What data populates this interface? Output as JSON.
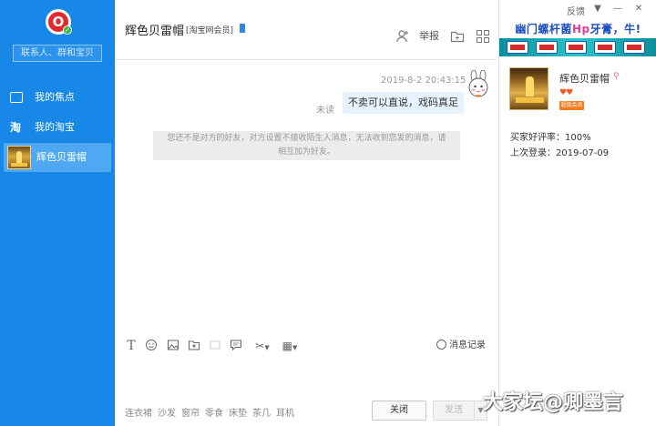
{
  "sidebar": {
    "logo_letter": "O",
    "search_placeholder": "联系人、群和宝贝",
    "items": [
      {
        "icon": "🖼",
        "label": "我的焦点"
      },
      {
        "icon": "淘",
        "label": "我的淘宝"
      },
      {
        "icon": "",
        "label": "辉色贝雷帽"
      }
    ]
  },
  "chat": {
    "title": "辉色贝雷帽",
    "member_badge": "[淘宝网会员]",
    "report_label": "举报",
    "message_time": "2019-8-2 20:43:15",
    "message_status": "未读",
    "message_text": "不卖可以直说，戏码真足",
    "notice_line1": "您还不是对方的好友，对方设置不接收陌生人消息，无法收到您发的消息，请",
    "notice_line2": "相互加为好友。"
  },
  "toolbar": {
    "history_label": "消息记录"
  },
  "footer": {
    "quick_tags": [
      "连衣裙",
      "沙发",
      "窗帘",
      "零食",
      "床垫",
      "茶几",
      "耳机"
    ],
    "close_label": "关闭",
    "send_label": "发送"
  },
  "right_panel": {
    "feedback_label": "反馈",
    "ad_text_before": "幽门螺杆菌",
    "ad_text_highlight": "Hp",
    "ad_text_after": "牙膏，牛!",
    "seller_name": "辉色贝雷帽",
    "hearts": "♥♥",
    "vip_badge": "超级会员",
    "praise_rate": "买家好评率：100%",
    "last_login": "上次登录：2019-07-09"
  },
  "watermark": "大家坛@卿墨言",
  "colors": {
    "sidebar_blue": "#1787e8",
    "active_item": "#4ea8f2",
    "bubble_bg": "#e6f2fd",
    "notice_bg": "#ececec"
  }
}
